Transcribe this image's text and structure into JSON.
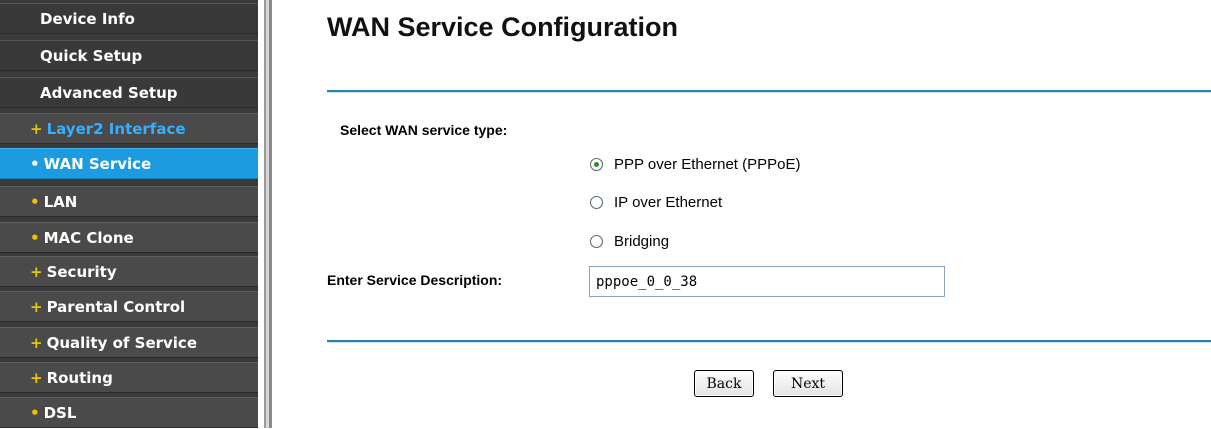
{
  "sidebar": {
    "items": [
      {
        "label": "Device Info",
        "bullet": "",
        "kind": "top"
      },
      {
        "label": "Quick Setup",
        "bullet": "",
        "kind": "top"
      },
      {
        "label": "Advanced Setup",
        "bullet": "",
        "kind": "top"
      },
      {
        "label": "Layer2 Interface",
        "bullet": "+",
        "kind": "current-section"
      },
      {
        "label": "WAN Service",
        "bullet": "•",
        "kind": "active"
      },
      {
        "label": "LAN",
        "bullet": "•",
        "kind": "sub"
      },
      {
        "label": "MAC Clone",
        "bullet": "•",
        "kind": "sub"
      },
      {
        "label": "Security",
        "bullet": "+",
        "kind": "sub"
      },
      {
        "label": "Parental Control",
        "bullet": "+",
        "kind": "sub"
      },
      {
        "label": "Quality of Service",
        "bullet": "+",
        "kind": "sub"
      },
      {
        "label": "Routing",
        "bullet": "+",
        "kind": "sub"
      },
      {
        "label": "DSL",
        "bullet": "•",
        "kind": "sub"
      }
    ]
  },
  "main": {
    "title": "WAN Service Configuration",
    "service_type_label": "Select WAN service type:",
    "options": [
      {
        "label": "PPP over Ethernet (PPPoE)",
        "checked": true
      },
      {
        "label": "IP over Ethernet",
        "checked": false
      },
      {
        "label": "Bridging",
        "checked": false
      }
    ],
    "description_label": "Enter Service Description:",
    "description_value": "pppoe_0_0_38",
    "back_label": "Back",
    "next_label": "Next"
  },
  "colors": {
    "sidebar_bg": "#3a3a3a",
    "active_item": "#1c9be0",
    "current_section_text": "#33b0ff",
    "bullet": "#e8c600",
    "rule": "#2e7db3"
  }
}
